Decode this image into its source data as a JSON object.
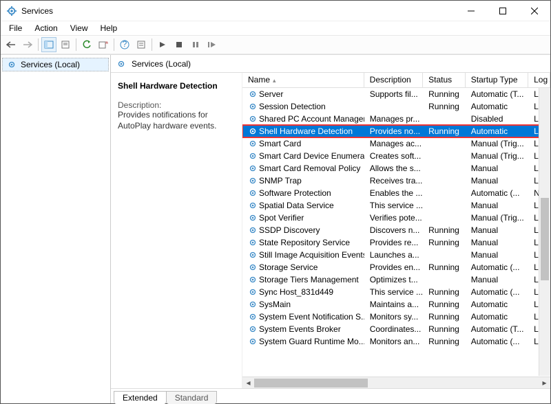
{
  "window": {
    "title": "Services"
  },
  "menu": {
    "file": "File",
    "action": "Action",
    "view": "View",
    "help": "Help"
  },
  "tree": {
    "root": "Services (Local)"
  },
  "header": {
    "title": "Services (Local)"
  },
  "detail": {
    "name": "Shell Hardware Detection",
    "description_label": "Description:",
    "description": "Provides notifications for AutoPlay hardware events."
  },
  "columns": {
    "name": "Name",
    "description": "Description",
    "status": "Status",
    "startup": "Startup Type",
    "logon": "Log"
  },
  "tabs": {
    "extended": "Extended",
    "standard": "Standard"
  },
  "services": [
    {
      "name": "Server",
      "desc": "Supports fil...",
      "status": "Running",
      "startup": "Automatic (T...",
      "log": "Loc"
    },
    {
      "name": "Session Detection",
      "desc": "",
      "status": "Running",
      "startup": "Automatic",
      "log": "Loc"
    },
    {
      "name": "Shared PC Account Manager",
      "desc": "Manages pr...",
      "status": "",
      "startup": "Disabled",
      "log": "Loc"
    },
    {
      "name": "Shell Hardware Detection",
      "desc": "Provides no...",
      "status": "Running",
      "startup": "Automatic",
      "log": "Loc",
      "selected": true
    },
    {
      "name": "Smart Card",
      "desc": "Manages ac...",
      "status": "",
      "startup": "Manual (Trig...",
      "log": "Loc"
    },
    {
      "name": "Smart Card Device Enumera...",
      "desc": "Creates soft...",
      "status": "",
      "startup": "Manual (Trig...",
      "log": "Loc"
    },
    {
      "name": "Smart Card Removal Policy",
      "desc": "Allows the s...",
      "status": "",
      "startup": "Manual",
      "log": "Loc"
    },
    {
      "name": "SNMP Trap",
      "desc": "Receives tra...",
      "status": "",
      "startup": "Manual",
      "log": "Loc"
    },
    {
      "name": "Software Protection",
      "desc": "Enables the ...",
      "status": "",
      "startup": "Automatic (...",
      "log": "Net"
    },
    {
      "name": "Spatial Data Service",
      "desc": "This service ...",
      "status": "",
      "startup": "Manual",
      "log": "Loc"
    },
    {
      "name": "Spot Verifier",
      "desc": "Verifies pote...",
      "status": "",
      "startup": "Manual (Trig...",
      "log": "Loc"
    },
    {
      "name": "SSDP Discovery",
      "desc": "Discovers n...",
      "status": "Running",
      "startup": "Manual",
      "log": "Loc"
    },
    {
      "name": "State Repository Service",
      "desc": "Provides re...",
      "status": "Running",
      "startup": "Manual",
      "log": "Loc"
    },
    {
      "name": "Still Image Acquisition Events",
      "desc": "Launches a...",
      "status": "",
      "startup": "Manual",
      "log": "Loc"
    },
    {
      "name": "Storage Service",
      "desc": "Provides en...",
      "status": "Running",
      "startup": "Automatic (...",
      "log": "Loc"
    },
    {
      "name": "Storage Tiers Management",
      "desc": "Optimizes t...",
      "status": "",
      "startup": "Manual",
      "log": "Loc"
    },
    {
      "name": "Sync Host_831d449",
      "desc": "This service ...",
      "status": "Running",
      "startup": "Automatic (...",
      "log": "Loc"
    },
    {
      "name": "SysMain",
      "desc": "Maintains a...",
      "status": "Running",
      "startup": "Automatic",
      "log": "Loc"
    },
    {
      "name": "System Event Notification S...",
      "desc": "Monitors sy...",
      "status": "Running",
      "startup": "Automatic",
      "log": "Loc"
    },
    {
      "name": "System Events Broker",
      "desc": "Coordinates...",
      "status": "Running",
      "startup": "Automatic (T...",
      "log": "Loc"
    },
    {
      "name": "System Guard Runtime Mo...",
      "desc": "Monitors an...",
      "status": "Running",
      "startup": "Automatic (...",
      "log": "Loc"
    }
  ]
}
